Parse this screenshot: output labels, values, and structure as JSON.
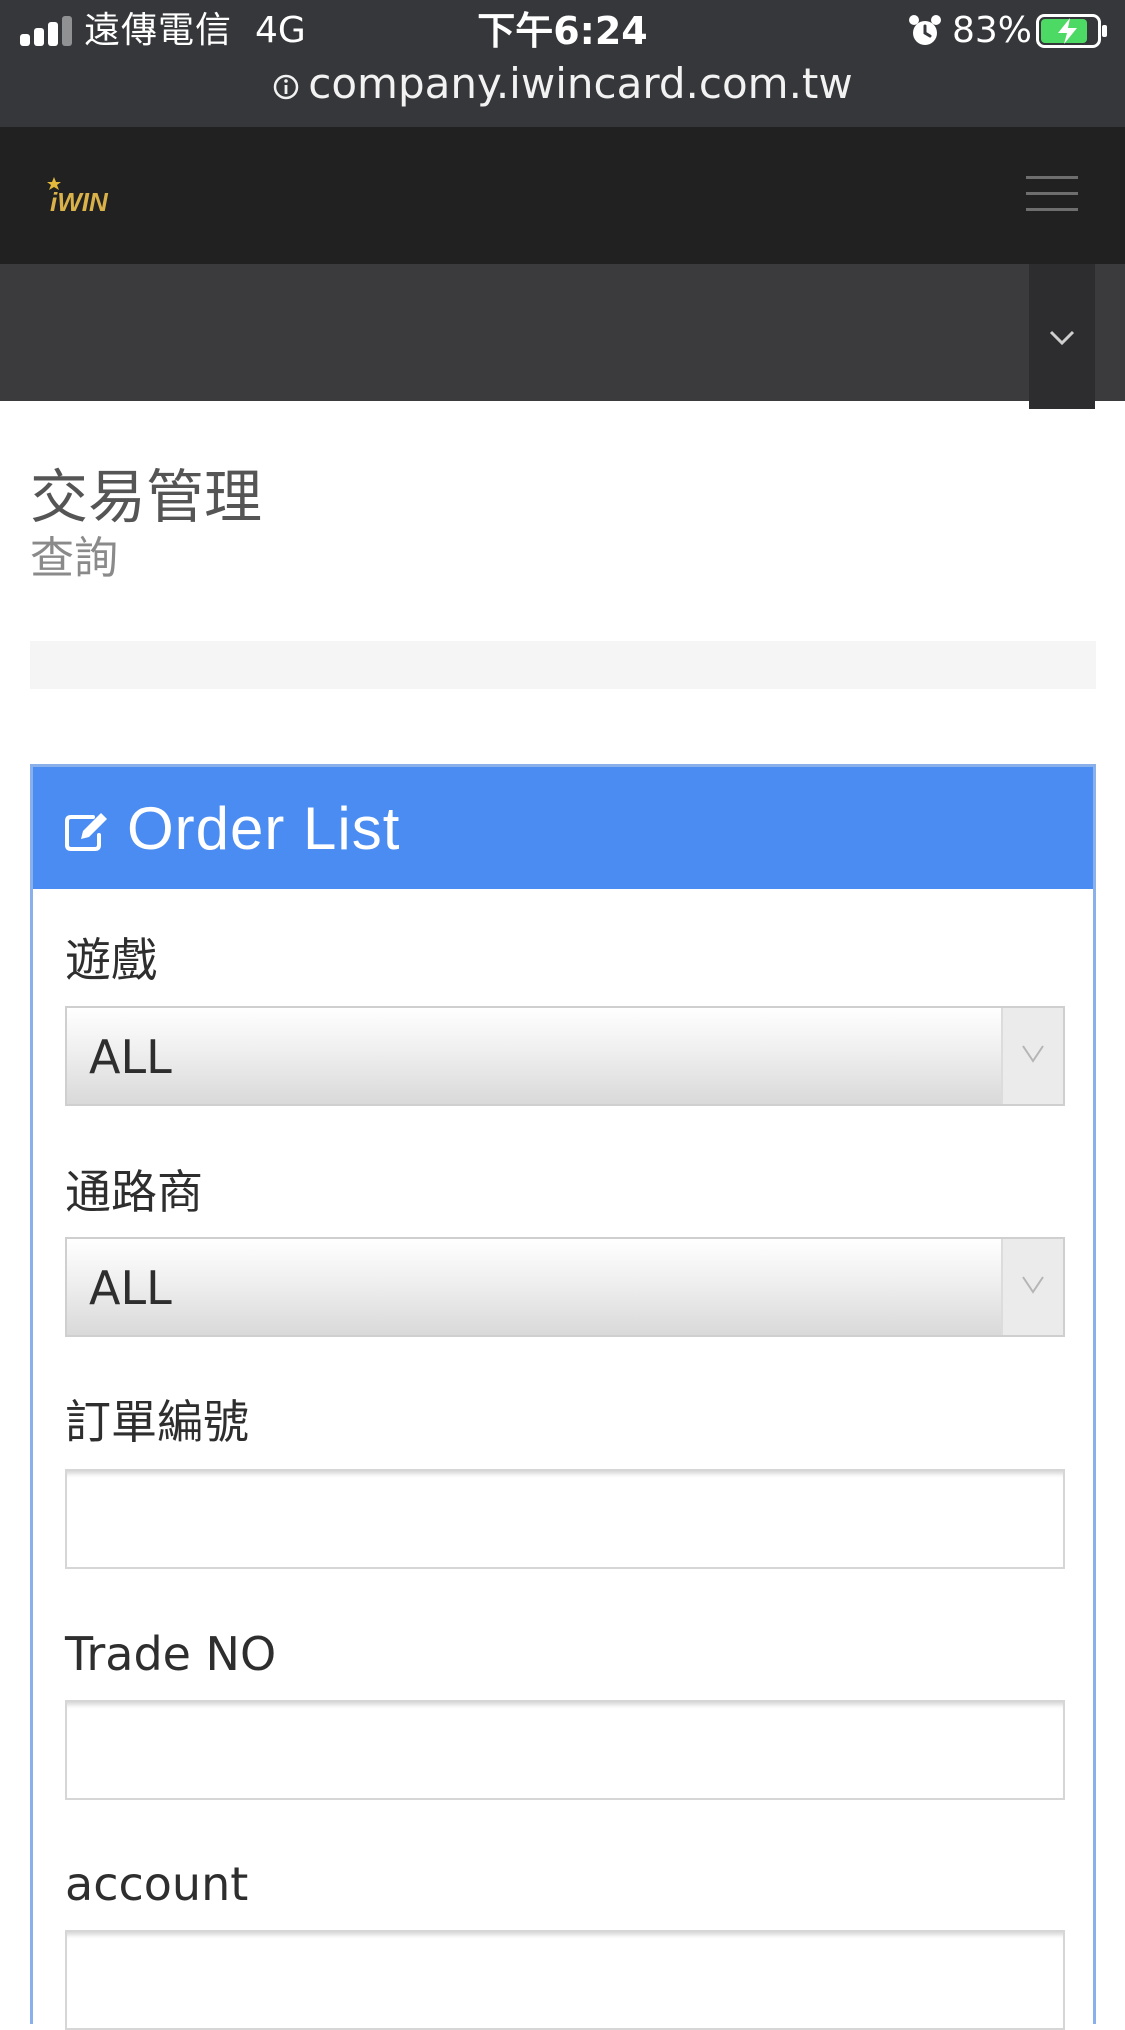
{
  "status_bar": {
    "carrier": "遠傳電信",
    "network": "4G",
    "time": "下午6:24",
    "battery_percent": "83%",
    "battery_level": 0.83,
    "url": "company.iwincard.com.tw"
  },
  "navbar": {
    "logo_text": "iWIN"
  },
  "page": {
    "title": "交易管理",
    "subtitle": "查詢"
  },
  "panel": {
    "title": "Order List",
    "fields": {
      "game": {
        "label": "遊戲",
        "value": "ALL"
      },
      "channel": {
        "label": "通路商",
        "value": "ALL"
      },
      "order_no": {
        "label": "訂單編號",
        "value": ""
      },
      "trade_no": {
        "label": "Trade NO",
        "value": ""
      },
      "account": {
        "label": "account",
        "value": ""
      }
    }
  },
  "colors": {
    "panel_heading": "#4a8cf2",
    "navbar": "#212121",
    "subbar": "#3b3b3d",
    "status_bar": "#36373a",
    "battery_fill": "#4cd964"
  }
}
